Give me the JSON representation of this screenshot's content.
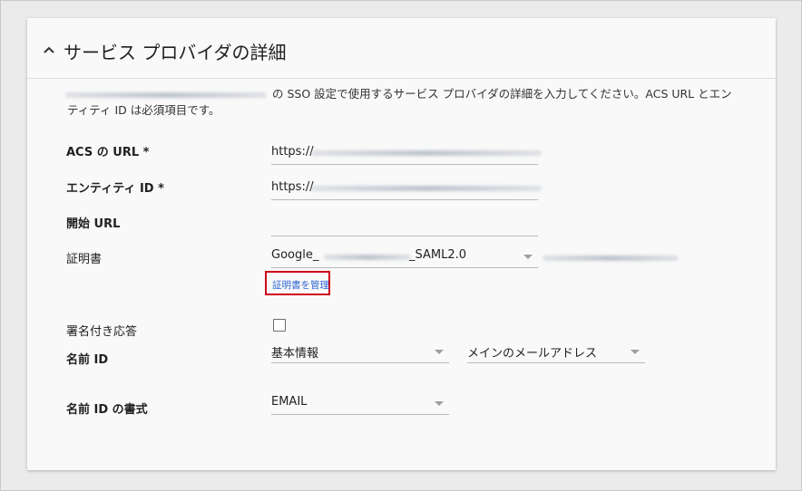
{
  "card": {
    "title": "サービス プロバイダの詳細"
  },
  "description": {
    "line1": "の SSO 設定で使用するサービス プロバイダの詳細を入力してください。ACS URL とエン",
    "line2": "ティティ ID は必須項目です。"
  },
  "fields": {
    "acs_url": {
      "label": "ACS の URL *",
      "value": "https://"
    },
    "entity_id": {
      "label": "エンティティ ID *",
      "value": "https://"
    },
    "start_url": {
      "label": "開始 URL",
      "value": ""
    },
    "certificate": {
      "label": "証明書",
      "value_prefix": "Google_",
      "value_suffix": "_SAML2.0"
    },
    "manage_certificates": {
      "label": "証明書を管理"
    },
    "signed_response": {
      "label": "署名付き応答",
      "checked": false
    },
    "name_id": {
      "label": "名前 ID",
      "primary_value": "基本情報",
      "secondary_value": "メインのメールアドレス"
    },
    "name_id_format": {
      "label": "名前 ID の書式",
      "value": "EMAIL"
    }
  },
  "colors": {
    "link": "#3367d6",
    "highlight_border": "#d0021b"
  }
}
